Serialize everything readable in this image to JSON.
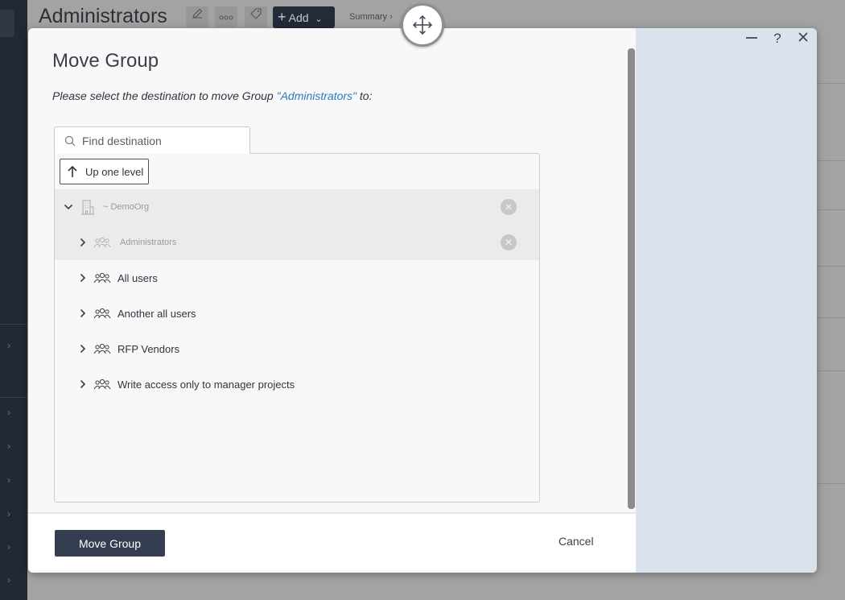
{
  "background": {
    "page_title": "Administrators",
    "add_label": "Add",
    "summary_label": "Summary"
  },
  "modal": {
    "title": "Move Group",
    "description_prefix": "Please select the destination to move Group ",
    "group_name": "\"Administrators\"",
    "description_suffix": " to:",
    "search": {
      "placeholder": "Find destination",
      "value": ""
    },
    "up_one_level": "Up one level",
    "tree": {
      "root": {
        "label": "~ DemoOrg",
        "icon": "building-icon",
        "expanded": true,
        "disabled": true
      },
      "items": [
        {
          "label": "Administrators",
          "icon": "group-icon",
          "disabled": true
        },
        {
          "label": "All users",
          "icon": "group-icon",
          "disabled": false
        },
        {
          "label": "Another all users",
          "icon": "group-icon",
          "disabled": false
        },
        {
          "label": "RFP Vendors",
          "icon": "group-icon",
          "disabled": false
        },
        {
          "label": "Write access only to manager projects",
          "icon": "group-icon",
          "disabled": false
        }
      ]
    },
    "primary_button": "Move Group",
    "cancel_button": "Cancel",
    "window_controls": [
      "minimize-icon",
      "help-icon",
      "close-icon"
    ],
    "colors": {
      "accent": "#353e50",
      "link": "#2a7bbf",
      "side_panel": "#d9e2ed"
    }
  }
}
